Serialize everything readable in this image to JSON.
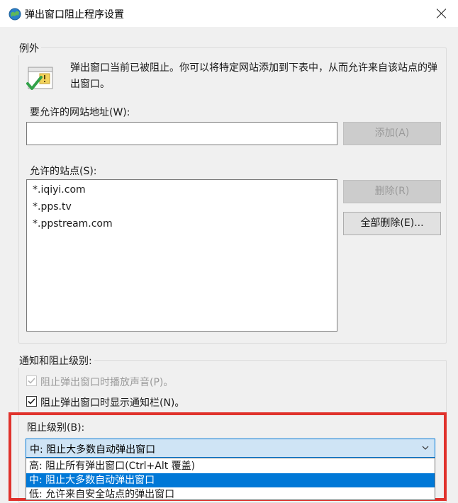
{
  "window": {
    "title": "弹出窗口阻止程序设置",
    "icon": "ie-globe-icon",
    "close_icon": "close-icon"
  },
  "exceptions": {
    "legend": "例外",
    "icon": "shield-check-icon",
    "description": "弹出窗口当前已被阻止。你可以将特定网站添加到下表中，从而允许来自该站点的弹出窗口。",
    "address_label": "要允许的网站地址(W):",
    "address_value": "",
    "add_button": "添加(A)",
    "allowed_label": "允许的站点(S):",
    "allowed_sites": [
      "*.iqiyi.com",
      "*.pps.tv",
      "*.ppstream.com"
    ],
    "remove_button": "删除(R)",
    "remove_all_button": "全部删除(E)..."
  },
  "notifications": {
    "legend": "通知和阻止级别:",
    "sound_label": "阻止弹出窗口时播放声音(P)。",
    "sound_checked": true,
    "sound_disabled": true,
    "bar_label": "阻止弹出窗口时显示通知栏(N)。",
    "bar_checked": true,
    "block_level_label": "阻止级别(B):",
    "block_level_value": "中: 阻止大多数自动弹出窗口",
    "block_level_options": [
      "高: 阻止所有弹出窗口(Ctrl+Alt 覆盖)",
      "中: 阻止大多数自动弹出窗口",
      "低: 允许来自安全站点的弹出窗口"
    ],
    "selected_index": 1,
    "chevron_icon": "chevron-down-icon"
  },
  "colors": {
    "highlight_frame": "#e0322c",
    "selection": "#0078d7"
  }
}
